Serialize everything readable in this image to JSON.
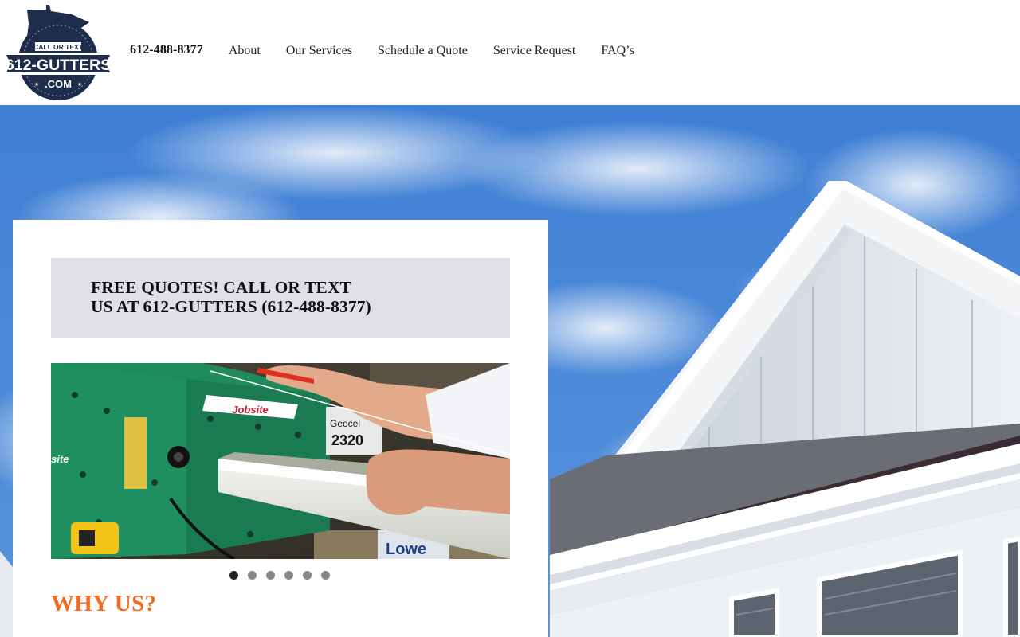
{
  "logo": {
    "top_text": "CALL OR TEXT",
    "main_text": "612-GUTTERS",
    "sub_text": ".COM"
  },
  "nav": {
    "phone": "612-488-8377",
    "items": [
      {
        "label": "About"
      },
      {
        "label": "Our Services"
      },
      {
        "label": "Schedule a Quote"
      },
      {
        "label": "Service Request"
      },
      {
        "label": "FAQ’s"
      }
    ]
  },
  "promo": {
    "line1": "FREE QUOTES! CALL OR TEXT",
    "line2": "US AT 612-GUTTERS (612-488-8377)"
  },
  "slideshow": {
    "machine_brand": "Jobsite",
    "box_brand": "Geocel",
    "store_brand": "Lowe",
    "slide_count": 6,
    "active_index": 0
  },
  "section": {
    "heading": "WHY US?"
  },
  "colors": {
    "accent": "#f26b21",
    "promo_bg": "#dfe0e6",
    "logo_navy": "#1f2d4d",
    "sky": "#4a86d6"
  }
}
